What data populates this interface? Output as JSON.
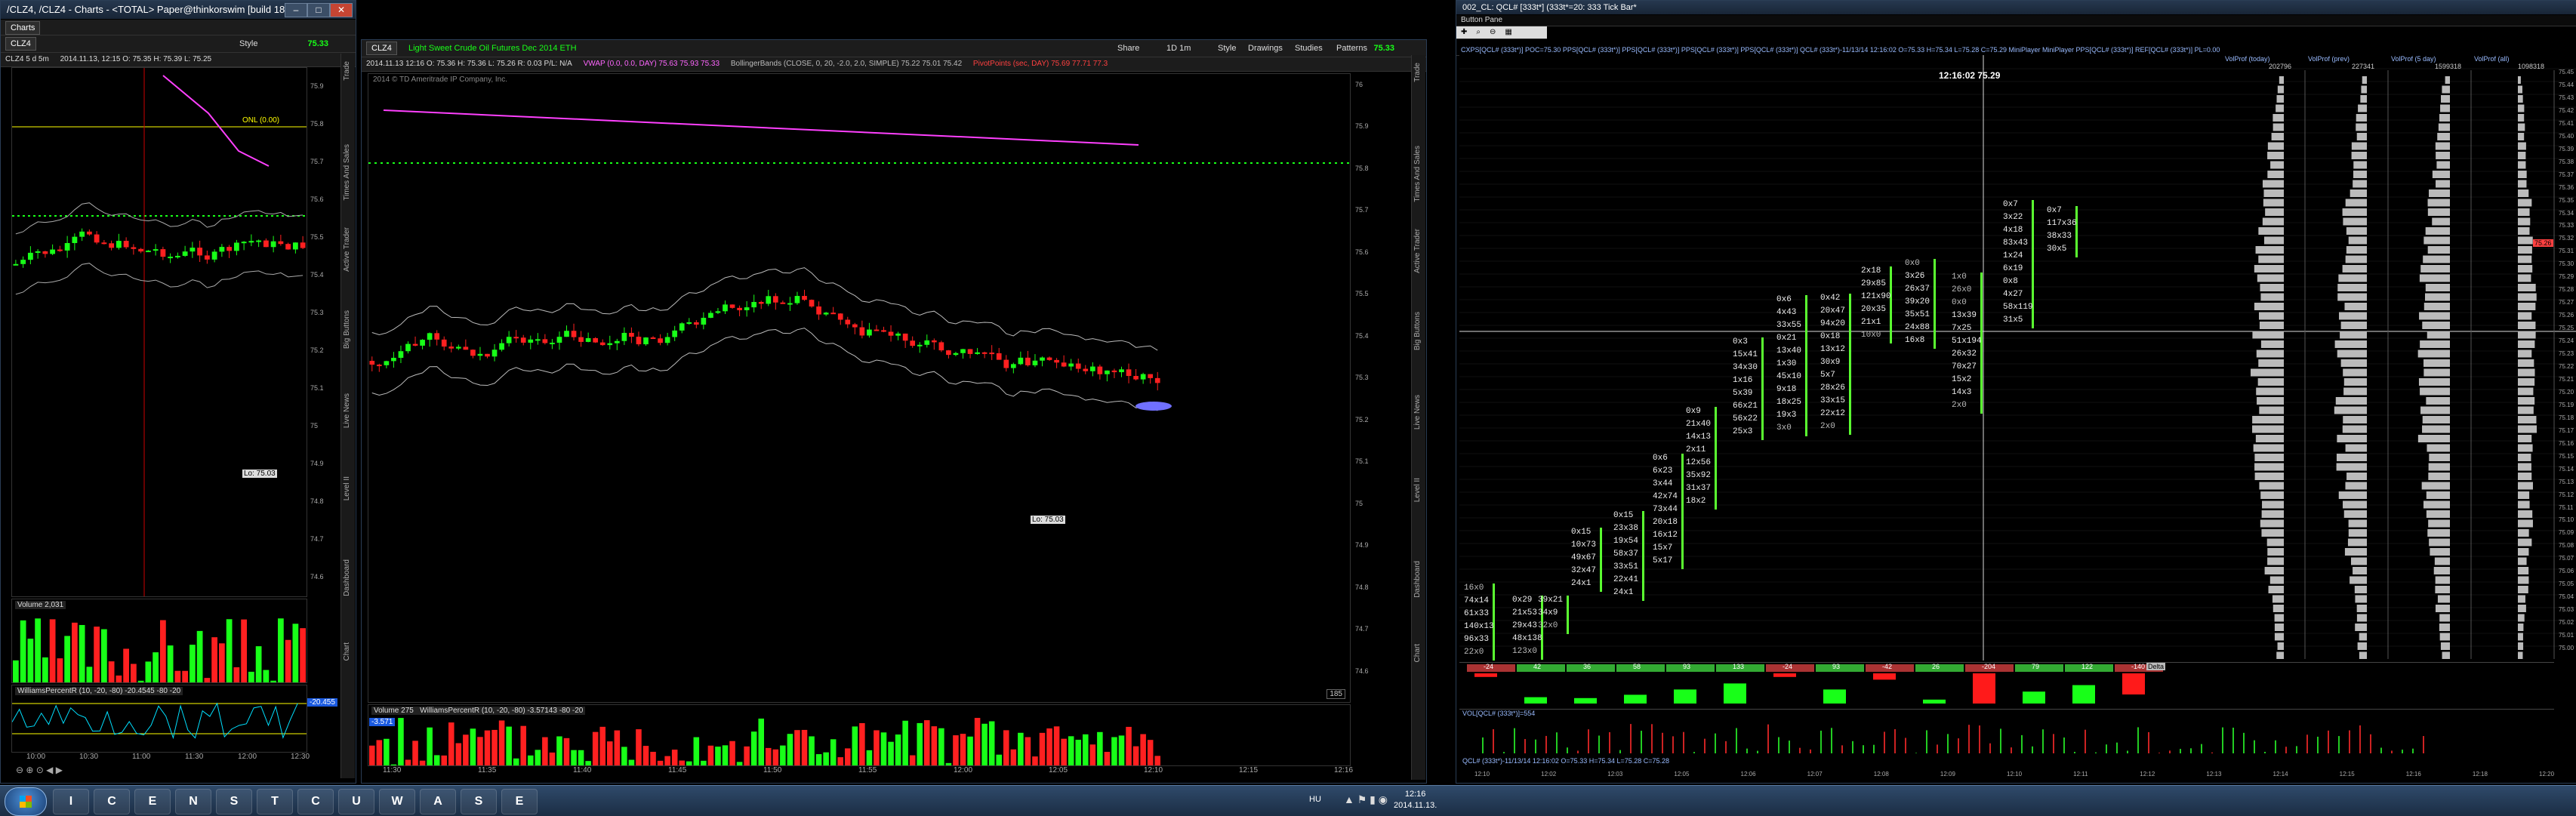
{
  "left_window": {
    "title": "/CLZ4, /CLZ4 - Charts - <TOTAL> Paper@thinkorswim [build 1866.23]",
    "tab": "Charts",
    "symbol": "CLZ4",
    "symbol_info": "CLZ4 5 d 5m",
    "quote": "2014.11.13, 12:15  O: 75.35  H: 75.39  L: 75.25",
    "last_price": "75.33",
    "style_label": "Style",
    "hline_label": "ONL (0.00)",
    "lo_label": "Lo: 75.03",
    "axis_prices": [
      "75.9",
      "75.8",
      "75.7",
      "75.6",
      "75.5",
      "75.4",
      "75.3",
      "75.2",
      "75.1",
      "75",
      "74.9",
      "74.8",
      "74.7",
      "74.6"
    ],
    "volume_label": "Volume  2,031",
    "williams_label": "WilliamsPercentR (10, -20, -80)  -20.4545  -80  -20",
    "williams_value": "-20.455",
    "time_ticks": [
      "10:00",
      "10:30",
      "11:00",
      "11:30",
      "12:00",
      "12:30"
    ],
    "side_tabs": [
      "Trade",
      "Times And Sales",
      "Active Trader",
      "Big Buttons",
      "Live News",
      "Level II",
      "Dashboard",
      "Chart"
    ]
  },
  "mid_window": {
    "symbol": "CLZ4",
    "title": "Light Sweet Crude Oil Futures Dec 2014 ETH",
    "share_label": "Share",
    "toolbar_items": [
      "Style",
      "Drawings",
      "Studies",
      "Patterns"
    ],
    "timeframe": "1D 1m",
    "quote": "2014.11.13 12:16  O: 75.36  H: 75.36  L: 75.26  R: 0.03  P/L: N/A",
    "vwap": "VWAP (0.0, 0.0, DAY)  75.63  75.93  75.33",
    "bollinger": "BollingerBands (CLOSE, 0, 20, -2.0, 2.0, SIMPLE)  75.22  75.01  75.42",
    "pivot": "PivotPoints (sec, DAY)  75.69  77.71  77.3",
    "last_price": "75.33",
    "copyright": "2014 © TD Ameritrade IP Company, Inc.",
    "lo_label": "Lo: 75.03",
    "bar_count": "185",
    "volume_label": "Volume  275",
    "williams_label": "WilliamsPercentR (10, -20, -80)  -3.57143  -80  -20",
    "williams_value": "-3.571",
    "axis_prices": [
      "76",
      "75.9",
      "75.8",
      "75.7",
      "75.6",
      "75.5",
      "75.4",
      "75.3",
      "75.2",
      "75.1",
      "75",
      "74.9",
      "74.8",
      "74.7",
      "74.6"
    ],
    "time_ticks": [
      "11:30",
      "11:35",
      "11:40",
      "11:45",
      "11:50",
      "11:55",
      "12:00",
      "12:05",
      "12:10",
      "12:15",
      "12:16"
    ],
    "side_tabs": [
      "Trade",
      "Times And Sales",
      "Active Trader",
      "Big Buttons",
      "Live News",
      "Level II",
      "Dashboard",
      "Chart"
    ]
  },
  "right_window": {
    "title": "002_CL: QCL# [333t*] (333t*=20: 333 Tick Bar*",
    "button_pane": "Button Pane",
    "header_strip": "CXPS[QCL# (333t*)] POC=75.30  PPS[QCL# (333t*)]  PPS[QCL# (333t*)]  PPS[QCL# (333t*)]  PPS[QCL# (333t*)]  QCL# (333t*)-11/13/14 12:16:02 O=75.33 H=75.34 L=75.28 C=75.29  MiniPlayer  MiniPlayer  PPS[QCL# (333t*)]  REF[QCL# (333t*)] PL=0.00",
    "cursor_readout": "12:16:02  75.29",
    "cursor_price": "75.26",
    "profiles": [
      {
        "name": "VolProf (today)",
        "value": "202796"
      },
      {
        "name": "VolProf (prev)",
        "value": "227341"
      },
      {
        "name": "VolProf (5 day)",
        "value": "1599318"
      },
      {
        "name": "VolProf (all)",
        "value": "1098318"
      }
    ],
    "delta_values": [
      "-24",
      "42",
      "36",
      "58",
      "93",
      "133",
      "-24",
      "93",
      "-42",
      "26",
      "-204",
      "79",
      "122",
      "-140"
    ],
    "delta_tag": "Delta",
    "indicator_label": "VOL[QCL# (333t*)]=554",
    "bottom_label": "QCL# (333t*)-11/13/14 12:16:02 O=75.33 H=75.34 L=75.28 C=75.28",
    "time_ticks": [
      "12:10",
      "12:02",
      "12:03",
      "12:05",
      "12:06",
      "12:07",
      "12:08",
      "12:09",
      "12:10",
      "12:11",
      "12:12",
      "12:13",
      "12:14",
      "12:15",
      "12:16",
      "12:18",
      "12:20"
    ],
    "axis_prices": [
      "75.45",
      "75.44",
      "75.43",
      "75.42",
      "75.41",
      "75.40",
      "75.39",
      "75.38",
      "75.37",
      "75.36",
      "75.35",
      "75.34",
      "75.33",
      "75.32",
      "75.31",
      "75.30",
      "75.29",
      "75.28",
      "75.27",
      "75.26",
      "75.25",
      "75.24",
      "75.23",
      "75.22",
      "75.21",
      "75.20",
      "75.19",
      "75.18",
      "75.17",
      "75.16",
      "75.15",
      "75.14",
      "75.13",
      "75.12",
      "75.11",
      "75.10",
      "75.09",
      "75.08",
      "75.07",
      "75.06",
      "75.05",
      "75.04",
      "75.03",
      "75.02",
      "75.01",
      "75.00"
    ],
    "footprint_columns": [
      [
        "16x0",
        "74x14",
        "61x33",
        "140x13",
        "96x33",
        "22x0"
      ],
      [
        "0x29",
        "21x53",
        "29x43",
        "48x138",
        "123x0"
      ],
      [
        "39x21",
        "34x9",
        "32x0"
      ],
      [
        "0x15",
        "10x73",
        "49x67",
        "32x47",
        "24x1"
      ],
      [
        "0x15",
        "23x38",
        "19x54",
        "58x37",
        "33x51",
        "22x41",
        "24x1"
      ],
      [
        "0x6",
        "6x23",
        "3x44",
        "42x74",
        "73x44",
        "20x18",
        "16x12",
        "15x7",
        "5x17"
      ],
      [
        "0x9",
        "21x40",
        "14x13",
        "2x11",
        "12x56",
        "35x92",
        "31x37",
        "18x2"
      ],
      [
        "0x3",
        "15x41",
        "34x30",
        "1x16",
        "5x39",
        "66x21",
        "56x22",
        "25x3"
      ],
      [
        "0x6",
        "4x43",
        "33x55",
        "0x21",
        "13x40",
        "1x30",
        "45x10",
        "9x18",
        "18x25",
        "19x3",
        "3x0"
      ],
      [
        "0x42",
        "20x47",
        "94x20",
        "0x18",
        "13x12",
        "30x9",
        "5x7",
        "28x26",
        "33x15",
        "22x12",
        "2x0"
      ],
      [
        "2x18",
        "29x85",
        "121x90",
        "20x35",
        "21x1",
        "10x0"
      ],
      [
        "0x0",
        "3x26",
        "26x37",
        "39x20",
        "35x51",
        "24x88",
        "16x8"
      ],
      [
        "1x0",
        "26x0",
        "0x0",
        "13x39",
        "7x25",
        "51x194",
        "26x32",
        "70x27",
        "15x2",
        "14x3",
        "2x0"
      ],
      [
        "0x7",
        "3x22",
        "4x18",
        "83x43",
        "1x24",
        "6x19",
        "0x8",
        "4x27",
        "58x119",
        "31x5"
      ],
      [
        "0x7",
        "117x36",
        "38x33",
        "30x5"
      ]
    ]
  },
  "taskbar": {
    "apps": [
      "IE",
      "Chrome",
      "Explorer",
      "Notepad",
      "Skype",
      "Tool",
      "Charts",
      "Utility",
      "Word",
      "Arrow",
      "Security",
      "Excel"
    ],
    "lang": "HU",
    "time": "12:16",
    "date": "2014.11.13."
  }
}
